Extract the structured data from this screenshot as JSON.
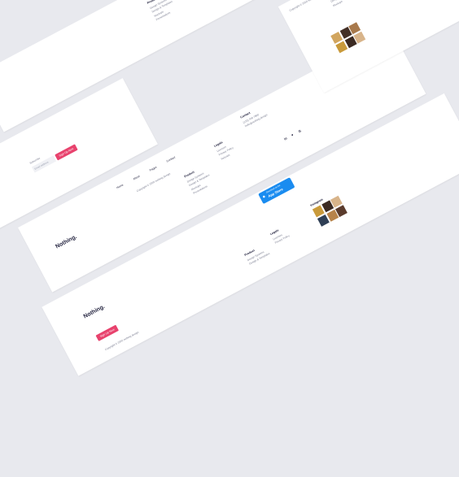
{
  "brand": {
    "logo": "Nothing."
  },
  "nav": [
    "Home",
    "About",
    "Pages",
    "Contact"
  ],
  "subscribe": {
    "label": "Subscribe",
    "placeholder": "Email address",
    "button": "Sign Up Now"
  },
  "copyright": "Copyright © 2020 nothing design",
  "columns": {
    "product": {
      "title": "Product",
      "items": [
        "Design Systems",
        "Design & Templates",
        "Mockups",
        "Presentations",
        "Illustrations",
        "Icons"
      ]
    },
    "legals": {
      "title": "Legals",
      "items": [
        "Licenses",
        "Privacy Policy",
        "Refunds",
        "Terms",
        "Cookies"
      ]
    },
    "contact": {
      "title": "Contact",
      "items": [
        "(123) 456 7890",
        "hello@nothing.design"
      ]
    }
  },
  "social": {
    "linkedin": "in",
    "twitter": "♥",
    "google": "G"
  },
  "appstore": {
    "small": "Download on the",
    "big": "App Store"
  },
  "instagram": {
    "title": "Instagram"
  },
  "colors": {
    "accent": "#e8426d",
    "appstore": "#1a8cf0",
    "background": "#e8e9ee",
    "ink": "#1d1d3a",
    "photos": [
      "#c99a3b",
      "#3b2a22",
      "#d8b48a",
      "#2f3f55",
      "#b7834a",
      "#5a3b2c",
      "#d1a55e",
      "#433026",
      "#a8794b"
    ]
  }
}
